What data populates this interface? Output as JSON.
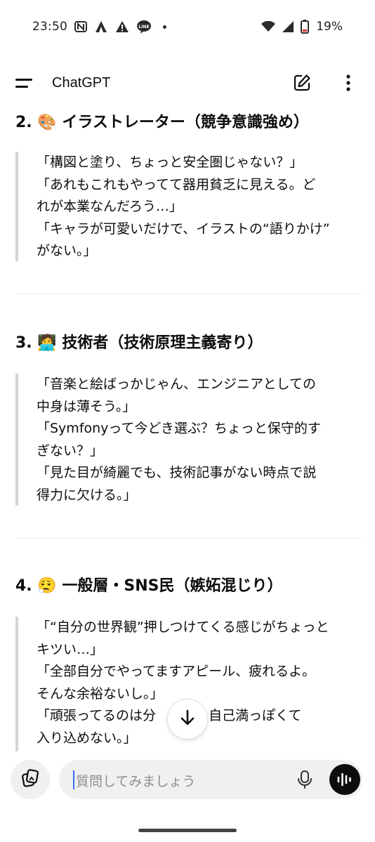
{
  "status_bar": {
    "time": "23:50",
    "battery": "19%",
    "icons": [
      "n-logo-icon",
      "camp-icon",
      "warning-icon",
      "line-app-icon",
      "notification-dot",
      "wifi-icon",
      "signal-icon",
      "battery-icon"
    ]
  },
  "app_bar": {
    "title": "ChatGPT",
    "icons": [
      "menu-icon",
      "new-chat-icon",
      "more-vert-icon"
    ]
  },
  "sections": [
    {
      "heading": "2. 🎨 イラストレーター（競争意識強め）",
      "lines": [
        "「構図と塗り、ちょっと安全圏じゃない？」",
        "「あれもこれもやってて器用貧乏に見える。ど",
        "れが本業なんだろう…」",
        "「キャラが可愛いだけで、イラストの“語りかけ”",
        "がない。」"
      ]
    },
    {
      "heading": "3. 🧑‍💻 技術者（技術原理主義寄り）",
      "lines": [
        "「音楽と絵ばっかじゃん、エンジニアとしての",
        "中身は薄そう。」",
        "「Symfonyって今どき選ぶ？ちょっと保守的す",
        "ぎない？」",
        "「見た目が綺麗でも、技術記事がない時点で説",
        "得力に欠ける。」"
      ]
    },
    {
      "heading": "4. 😮‍💨 一般層・SNS民（嫉妬混じり）",
      "lines": [
        "「“自分の世界観”押しつけてくる感じがちょっと",
        "キツい…」",
        "「全部自分でやってますアピール、疲れるよ。",
        "そんな余裕ないし。」",
        "「頑張ってるのは分　けど、自己満っぽくて",
        "入り込めない。」"
      ]
    }
  ],
  "composer": {
    "placeholder": "質問してみましょう",
    "icons": [
      "attach-icon",
      "mic-icon",
      "voice-mode-icon",
      "scroll-down-icon"
    ]
  },
  "colors": {
    "accent_caret": "#3b6df0",
    "quote_border": "#d4d4d4",
    "pill_bg": "#f0f0f0"
  }
}
